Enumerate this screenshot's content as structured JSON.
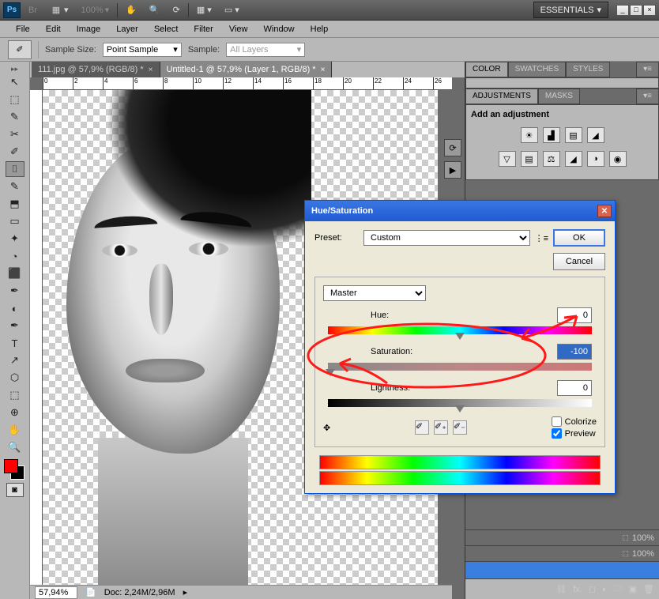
{
  "top": {
    "zoom": "100%",
    "workspace": "ESSENTIALS"
  },
  "menu": [
    "File",
    "Edit",
    "Image",
    "Layer",
    "Select",
    "Filter",
    "View",
    "Window",
    "Help"
  ],
  "options": {
    "sampleSizeLabel": "Sample Size:",
    "sampleSizeValue": "Point Sample",
    "sampleLabel": "Sample:",
    "sampleValue": "All Layers"
  },
  "tabs": [
    {
      "label": "111.jpg @ 57,9% (RGB/8) *",
      "active": false
    },
    {
      "label": "Untitled-1 @ 57,9% (Layer 1, RGB/8) *",
      "active": true
    }
  ],
  "tools": [
    "↖",
    "⬚",
    "✎",
    "✂",
    "✐",
    "⌷",
    "✎",
    "⬒",
    "▭",
    "✦",
    "◔",
    "⬛",
    "✒",
    "T",
    "↗",
    "⬡",
    "✋",
    "🔍"
  ],
  "status": {
    "zoom": "57,94%",
    "doc": "Doc: 2,24M/2,96M"
  },
  "panels": {
    "colorTabs": [
      "COLOR",
      "SWATCHES",
      "STYLES"
    ],
    "adjTabs": [
      "ADJUSTMENTS",
      "MASKS"
    ],
    "adjTitle": "Add an adjustment",
    "row1": [
      "☀",
      "▟",
      "▤",
      "◢"
    ],
    "row2": [
      "▽",
      "▤",
      "⚖",
      "◢",
      "◑",
      "◉"
    ]
  },
  "dialog": {
    "title": "Hue/Saturation",
    "presetLabel": "Preset:",
    "presetValue": "Custom",
    "ok": "OK",
    "cancel": "Cancel",
    "channel": "Master",
    "hueLabel": "Hue:",
    "hueValue": "0",
    "satLabel": "Saturation:",
    "satValue": "-100",
    "lightLabel": "Lightness:",
    "lightValue": "0",
    "colorize": "Colorize",
    "preview": "Preview"
  },
  "panelOpacity": "100%"
}
